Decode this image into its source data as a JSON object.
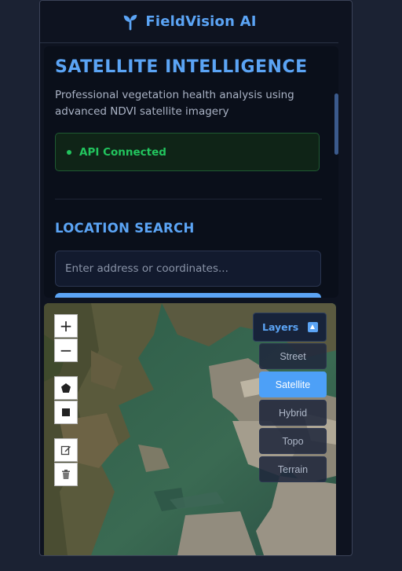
{
  "app": {
    "title": "FieldVision AI",
    "logo_icon": "sprout-icon",
    "accent": "#5ba4f5"
  },
  "hero": {
    "headline": "SATELLITE INTELLIGENCE",
    "description": "Professional vegetation health analysis using advanced NDVI satellite imagery"
  },
  "status": {
    "label": "API Connected",
    "color": "#22c55e"
  },
  "location": {
    "section_title": "LOCATION SEARCH",
    "placeholder": "Enter address or coordinates...",
    "value": ""
  },
  "map": {
    "zoom_in": "+",
    "zoom_out": "−",
    "tools": [
      "polygon-draw-icon",
      "rectangle-draw-icon",
      "edit-icon",
      "trash-icon"
    ],
    "layers": {
      "title": "Layers",
      "options": [
        "Street",
        "Satellite",
        "Hybrid",
        "Topo",
        "Terrain"
      ],
      "selected": "Satellite"
    }
  }
}
